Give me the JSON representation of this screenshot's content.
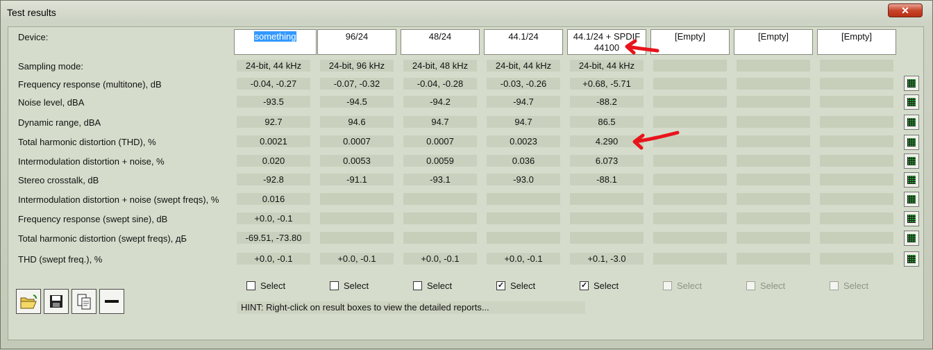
{
  "window": {
    "title": "Test results",
    "close_label": "✕"
  },
  "device_label": "Device:",
  "devices": [
    "something",
    "96/24",
    "48/24",
    "44.1/24",
    "44.1/24 + SPDIF\n44100",
    "[Empty]",
    "[Empty]",
    "[Empty]"
  ],
  "rows": [
    {
      "label": "Sampling mode:",
      "values": [
        "24-bit, 44 kHz",
        "24-bit, 96 kHz",
        "24-bit, 48 kHz",
        "24-bit, 44 kHz",
        "24-bit, 44 kHz",
        "",
        "",
        ""
      ]
    },
    {
      "label": "Frequency response (multitone), dB",
      "values": [
        "-0.04, -0.27",
        "-0.07, -0.32",
        "-0.04, -0.28",
        "-0.03, -0.26",
        "+0.68, -5.71",
        "",
        "",
        ""
      ]
    },
    {
      "label": "Noise level, dBA",
      "values": [
        "-93.5",
        "-94.5",
        "-94.2",
        "-94.7",
        "-88.2",
        "",
        "",
        ""
      ]
    },
    {
      "label": "Dynamic range, dBA",
      "values": [
        "92.7",
        "94.6",
        "94.7",
        "94.7",
        "86.5",
        "",
        "",
        ""
      ]
    },
    {
      "label": "Total harmonic distortion (THD), %",
      "values": [
        "0.0021",
        "0.0007",
        "0.0007",
        "0.0023",
        "4.290",
        "",
        "",
        ""
      ]
    },
    {
      "label": "Intermodulation distortion + noise, %",
      "values": [
        "0.020",
        "0.0053",
        "0.0059",
        "0.036",
        "6.073",
        "",
        "",
        ""
      ]
    },
    {
      "label": "Stereo crosstalk, dB",
      "values": [
        "-92.8",
        "-91.1",
        "-93.1",
        "-93.0",
        "-88.1",
        "",
        "",
        ""
      ]
    },
    {
      "label": "Intermodulation distortion + noise (swept freqs), %",
      "values": [
        "0.016",
        "",
        "",
        "",
        "",
        "",
        "",
        ""
      ]
    },
    {
      "label": "Frequency response (swept sine), dB",
      "values": [
        "+0.0, -0.1",
        "",
        "",
        "",
        "",
        "",
        "",
        ""
      ]
    },
    {
      "label": "Total harmonic distortion (swept freqs), дБ",
      "values": [
        "-69.51, -73.80",
        "",
        "",
        "",
        "",
        "",
        "",
        ""
      ]
    },
    {
      "label": "THD (swept freq.), %",
      "values": [
        "+0.0, -0.1",
        "+0.0, -0.1",
        "+0.0, -0.1",
        "+0.0, -0.1",
        "+0.1, -3.0",
        "",
        "",
        ""
      ]
    }
  ],
  "select": {
    "label": "Select",
    "checked": [
      false,
      false,
      false,
      true,
      true,
      false,
      false,
      false
    ],
    "enabled": [
      true,
      true,
      true,
      true,
      true,
      false,
      false,
      false
    ]
  },
  "hint": "HINT: Right-click on result boxes to view the detailed reports...",
  "toolbar": [
    "open-folder-icon",
    "save-disk-icon",
    "copy-pages-icon",
    "minus-icon"
  ],
  "colors": {
    "accent_selection": "#3399ff",
    "annotation_arrow": "#e8141c",
    "report_icon": "#2fa83a"
  }
}
